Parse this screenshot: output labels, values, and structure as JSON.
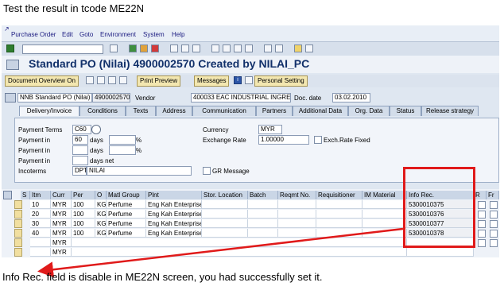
{
  "instruction": "Test the result in tcode ME22N",
  "note": "Info Rec. field is disable in ME22N screen, you had successfully set it.",
  "menu": [
    "Purchase Order",
    "Edit",
    "Goto",
    "Environment",
    "System",
    "Help"
  ],
  "title": "Standard PO (Nilai) 4900002570 Created by NILAI_PC",
  "buttons": {
    "doc_overview": "Document Overview On",
    "print_preview": "Print Preview",
    "messages": "Messages",
    "personal_setting": "Personal Setting"
  },
  "header": {
    "doc_type": "NNB Standard PO (Nilai)",
    "po_number": "4900002570",
    "vendor_label": "Vendor",
    "vendor": "400033 EAC INDUSTRIAL INGRED",
    "doc_date_label": "Doc. date",
    "doc_date": "03.02.2010"
  },
  "tabs": [
    "Delivery/Invoice",
    "Conditions",
    "Texts",
    "Address",
    "Communication",
    "Partners",
    "Additional Data",
    "Org. Data",
    "Status",
    "Release strategy"
  ],
  "form": {
    "payment_terms_label": "Payment Terms",
    "payment_terms": "C60",
    "payment_in_label": "Payment in",
    "days1": "60",
    "days_label": "days",
    "percent": "%",
    "days_net": "days net",
    "incoterms_label": "Incoterms",
    "incoterms_code": "DPT",
    "incoterms_text": "NILAI",
    "currency_label": "Currency",
    "currency": "MYR",
    "exchange_label": "Exchange Rate",
    "exchange_rate": "1.00000",
    "exch_fixed_label": "Exch.Rate Fixed",
    "gr_message_label": "GR Message"
  },
  "grid": {
    "headers": [
      "S",
      "Itm",
      "Curr",
      "Per",
      "O",
      "Matl Group",
      "Plnt",
      "Stor. Location",
      "Batch",
      "Reqmt No.",
      "Requisitioner",
      "IM Material",
      "Info Rec.",
      "R",
      "Fr"
    ],
    "rows": [
      {
        "itm": "10",
        "curr": "MYR",
        "per": "100",
        "o": "KG",
        "matl": "Perfume",
        "plnt": "Eng Kah Enterprise",
        "info": "5300010375"
      },
      {
        "itm": "20",
        "curr": "MYR",
        "per": "100",
        "o": "KG",
        "matl": "Perfume",
        "plnt": "Eng Kah Enterprise",
        "info": "5300010376"
      },
      {
        "itm": "30",
        "curr": "MYR",
        "per": "100",
        "o": "KG",
        "matl": "Perfume",
        "plnt": "Eng Kah Enterprise",
        "info": "5300010377"
      },
      {
        "itm": "40",
        "curr": "MYR",
        "per": "100",
        "o": "KG",
        "matl": "Perfume",
        "plnt": "Eng Kah Enterprise",
        "info": "5300010378"
      },
      {
        "itm": "",
        "curr": "MYR",
        "per": "",
        "o": "",
        "matl": "",
        "plnt": "",
        "info": ""
      },
      {
        "itm": "",
        "curr": "MYR",
        "per": "",
        "o": "",
        "matl": "",
        "plnt": "",
        "info": ""
      }
    ]
  },
  "colors": {
    "highlight": "#e01a1a",
    "title": "#11306a",
    "button": "#f3e7b0"
  }
}
